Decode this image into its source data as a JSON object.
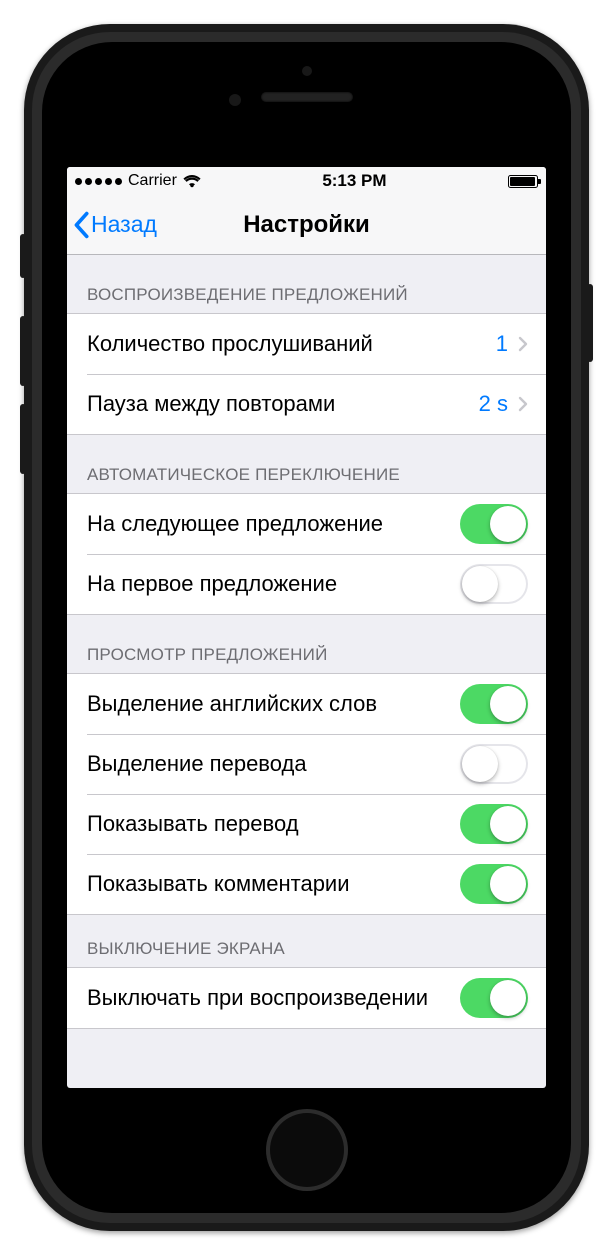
{
  "status": {
    "carrier": "Carrier",
    "time": "5:13 PM"
  },
  "nav": {
    "back": "Назад",
    "title": "Настройки"
  },
  "sections": {
    "playback": {
      "header": "ВОСПРОИЗВЕДЕНИЕ ПРЕДЛОЖЕНИЙ",
      "listenCount": {
        "label": "Количество прослушиваний",
        "value": "1"
      },
      "pause": {
        "label": "Пауза между повторами",
        "value": "2 s"
      }
    },
    "autoSwitch": {
      "header": "АВТОМАТИЧЕСКОЕ ПЕРЕКЛЮЧЕНИЕ",
      "next": {
        "label": "На следующее предложение",
        "on": true
      },
      "first": {
        "label": "На первое предложение",
        "on": false
      }
    },
    "view": {
      "header": "ПРОСМОТР ПРЕДЛОЖЕНИЙ",
      "hlEnglish": {
        "label": "Выделение английских слов",
        "on": true
      },
      "hlTrans": {
        "label": "Выделение перевода",
        "on": false
      },
      "showTrans": {
        "label": "Показывать перевод",
        "on": true
      },
      "showComment": {
        "label": "Показывать комментарии",
        "on": true
      }
    },
    "screenOff": {
      "header": "ВЫКЛЮЧЕНИЕ ЭКРАНА",
      "disableOnPlay": {
        "label": "Выключать при воспроизведении",
        "on": true
      }
    }
  },
  "colors": {
    "tint": "#007aff",
    "switchOn": "#4cd964",
    "groupBg": "#efeff4",
    "hairline": "#c8c7cc"
  }
}
